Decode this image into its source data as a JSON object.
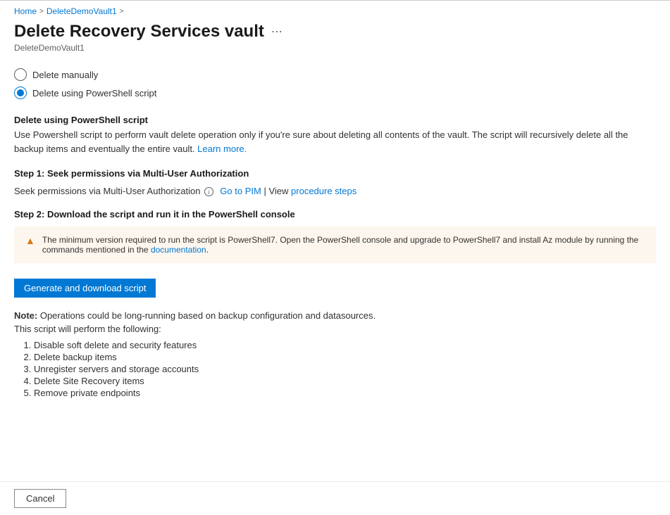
{
  "breadcrumb": {
    "home": "Home",
    "vault": "DeleteDemoVault1"
  },
  "header": {
    "title": "Delete Recovery Services vault",
    "subtitle": "DeleteDemoVault1"
  },
  "radio": {
    "option1": "Delete manually",
    "option2": "Delete using PowerShell script"
  },
  "section": {
    "heading": "Delete using PowerShell script",
    "descPart1": "Use Powershell script to perform vault delete operation only if you're sure about deleting all contents of the vault. The script will recursively delete all the backup items and eventually the entire vault. ",
    "learnMore": "Learn more."
  },
  "step1": {
    "heading": "Step 1: Seek permissions via Multi-User Authorization",
    "text": "Seek permissions via Multi-User Authorization",
    "goToPim": "Go to PIM",
    "viewLabel": "View",
    "procedureSteps": "procedure steps"
  },
  "step2": {
    "heading": "Step 2: Download the script and run it in the PowerShell console"
  },
  "warning": {
    "text": "The minimum version required to run the script is PowerShell7. Open the PowerShell console and upgrade to PowerShell7 and install Az module by running the commands mentioned in the ",
    "docLink": "documentation",
    "period": "."
  },
  "buttons": {
    "generate": "Generate and download script",
    "cancel": "Cancel"
  },
  "note": {
    "label": "Note:",
    "text": " Operations could be long-running based on backup configuration and datasources.",
    "followingText": "This script will perform the following:"
  },
  "list": {
    "items": [
      "Disable soft delete and security features",
      "Delete backup items",
      "Unregister servers and storage accounts",
      "Delete Site Recovery items",
      "Remove private endpoints"
    ]
  }
}
